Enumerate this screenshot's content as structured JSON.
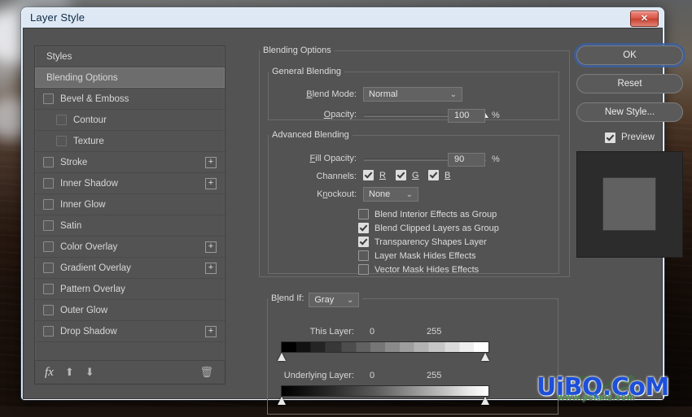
{
  "window": {
    "title": "Layer Style",
    "close_label": "✕"
  },
  "styles_panel": {
    "header": "Styles",
    "selected": "Blending Options",
    "items": [
      {
        "label": "Bevel & Emboss",
        "checked": false,
        "sub": false,
        "plus": false
      },
      {
        "label": "Contour",
        "checked": false,
        "sub": true,
        "plus": false
      },
      {
        "label": "Texture",
        "checked": false,
        "sub": true,
        "plus": false
      },
      {
        "label": "Stroke",
        "checked": false,
        "sub": false,
        "plus": true
      },
      {
        "label": "Inner Shadow",
        "checked": false,
        "sub": false,
        "plus": true
      },
      {
        "label": "Inner Glow",
        "checked": false,
        "sub": false,
        "plus": false
      },
      {
        "label": "Satin",
        "checked": false,
        "sub": false,
        "plus": false
      },
      {
        "label": "Color Overlay",
        "checked": false,
        "sub": false,
        "plus": true
      },
      {
        "label": "Gradient Overlay",
        "checked": false,
        "sub": false,
        "plus": true
      },
      {
        "label": "Pattern Overlay",
        "checked": false,
        "sub": false,
        "plus": false
      },
      {
        "label": "Outer Glow",
        "checked": false,
        "sub": false,
        "plus": false
      },
      {
        "label": "Drop Shadow",
        "checked": false,
        "sub": false,
        "plus": true
      }
    ],
    "footer": {
      "fx_icon": "fx",
      "up_icon": "⬆",
      "down_icon": "⬇",
      "trash_icon": "🗑"
    },
    "plus_glyph": "+"
  },
  "blending": {
    "section_title": "Blending Options",
    "general": {
      "legend": "General Blending",
      "blend_mode_label": "Blend Mode:",
      "blend_mode_value": "Normal",
      "opacity_label": "Opacity:",
      "opacity_value": "100",
      "opacity_percent": "%"
    },
    "advanced": {
      "legend": "Advanced Blending",
      "fill_opacity_label": "Fill Opacity:",
      "fill_opacity_value": "90",
      "fill_opacity_percent": "%",
      "channels_label": "Channels:",
      "channels": [
        {
          "label": "R",
          "checked": true
        },
        {
          "label": "G",
          "checked": true
        },
        {
          "label": "B",
          "checked": true
        }
      ],
      "knockout_label": "Knockout:",
      "knockout_value": "None",
      "options": [
        {
          "label": "Blend Interior Effects as Group",
          "checked": false
        },
        {
          "label": "Blend Clipped Layers as Group",
          "checked": true
        },
        {
          "label": "Transparency Shapes Layer",
          "checked": true
        },
        {
          "label": "Layer Mask Hides Effects",
          "checked": false
        },
        {
          "label": "Vector Mask Hides Effects",
          "checked": false
        }
      ]
    },
    "blend_if": {
      "label": "Blend If:",
      "channel_value": "Gray",
      "this_layer_label": "This Layer:",
      "this_layer_min": "0",
      "this_layer_max": "255",
      "underlying_layer_label": "Underlying Layer:",
      "underlying_layer_min": "0",
      "underlying_layer_max": "255"
    }
  },
  "buttons": {
    "ok": "OK",
    "reset": "Reset",
    "new_style": "New Style...",
    "preview_label": "Preview",
    "preview_checked": true
  },
  "watermark": {
    "main": "UiBQ.CoM",
    "sub": "www.psianz.com"
  },
  "colors": {
    "panel_bg": "#535353",
    "accent_focus": "#3c5fa0",
    "text": "#d5d5d5",
    "titlebar_text": "#0d2a44",
    "close_red": "#c9412f",
    "watermark_blue": "#1d4fd8"
  }
}
